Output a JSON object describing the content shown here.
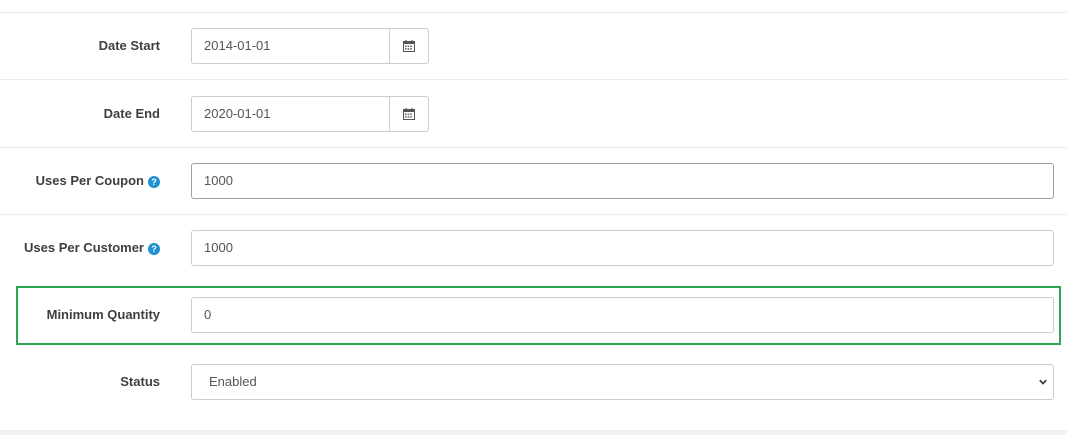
{
  "rows": {
    "date_start": {
      "label": "Date Start",
      "value": "2014-01-01",
      "button_icon": "calendar-icon"
    },
    "date_end": {
      "label": "Date End",
      "value": "2020-01-01",
      "button_icon": "calendar-icon"
    },
    "uses_per_coupon": {
      "label": "Uses Per Coupon",
      "value": "1000",
      "help_icon": "question-circle-icon"
    },
    "uses_per_customer": {
      "label": "Uses Per Customer",
      "value": "1000",
      "help_icon": "question-circle-icon"
    },
    "minimum_quantity": {
      "label": "Minimum Quantity",
      "value": "0"
    },
    "status": {
      "label": "Status",
      "selected": "Enabled"
    }
  },
  "colors": {
    "highlight": "#2ea54f",
    "help_icon": "#1e91cf",
    "border": "#cccccc"
  }
}
